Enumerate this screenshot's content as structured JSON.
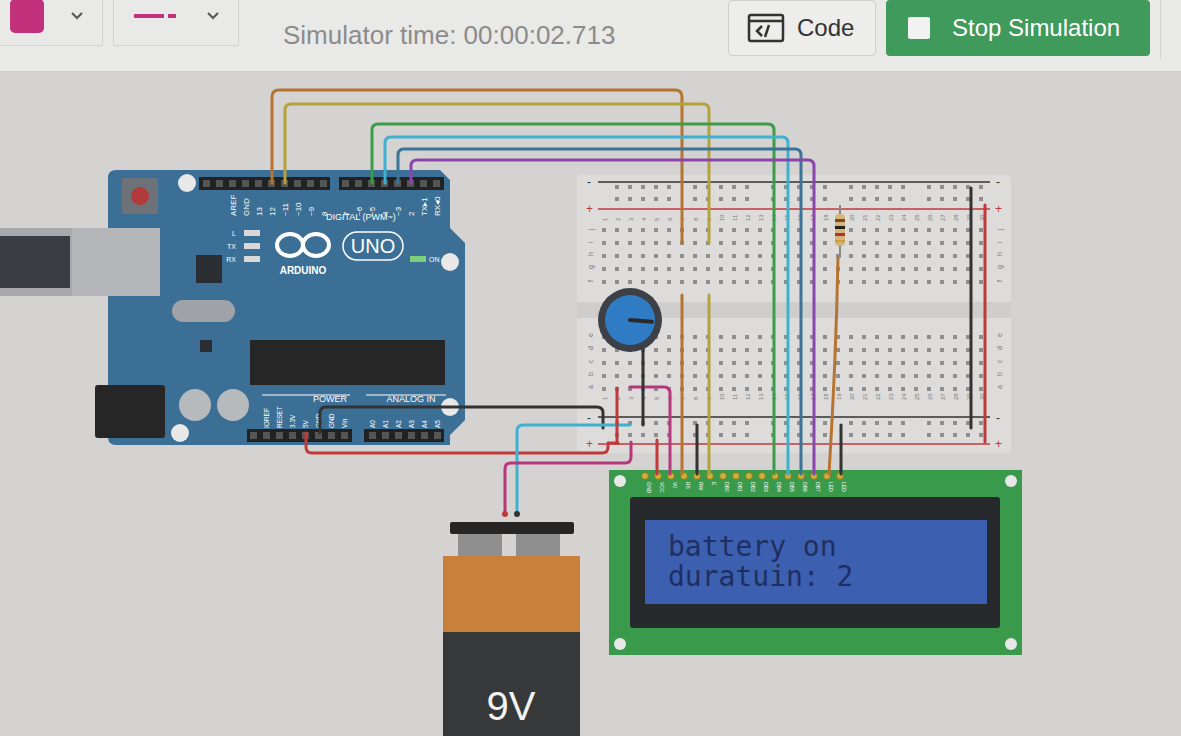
{
  "toolbar": {
    "color_picker": {
      "color": "#c2317c"
    },
    "line_style": {
      "color": "#c2317c"
    },
    "simulator_time": "Simulator time: 00:00:02.713",
    "code_button": {
      "label": "Code"
    },
    "stop_button": {
      "label": "Stop Simulation"
    }
  },
  "arduino": {
    "digital_labels_left": [
      "AREF",
      "GND",
      "13",
      "12",
      "~11",
      "~10",
      "~9",
      "8"
    ],
    "digital_labels_right": [
      "7",
      "~6",
      "~5",
      "4",
      "~3",
      "2",
      "TX▸1",
      "RX◂0"
    ],
    "digital_title": "DIGITAL (PWM~)",
    "led_labels": [
      "L",
      "TX",
      "RX"
    ],
    "on_label": "ON",
    "brand": "ARDUINO",
    "model": "UNO",
    "power_title": "POWER",
    "analog_title": "ANALOG IN",
    "power_labels": [
      "IOREF",
      "RESET",
      "3.3V",
      "5V",
      "GND",
      "GND",
      "Vin"
    ],
    "analog_labels": [
      "A0",
      "A1",
      "A2",
      "A3",
      "A4",
      "A5"
    ]
  },
  "breadboard": {
    "columns": [
      "1",
      "2",
      "3",
      "4",
      "5",
      "6",
      "7",
      "8",
      "9",
      "10",
      "11",
      "12",
      "13",
      "14",
      "15",
      "16",
      "17",
      "18",
      "19",
      "20",
      "21",
      "22",
      "23",
      "24",
      "25",
      "26",
      "27",
      "28",
      "29",
      "30"
    ],
    "rows_top": [
      "j",
      "i",
      "h",
      "g",
      "f"
    ],
    "rows_bottom": [
      "e",
      "d",
      "c",
      "b",
      "a"
    ],
    "rail_minus": "-",
    "rail_plus": "+"
  },
  "potentiometer": {
    "level": 0.85
  },
  "lcd": {
    "lines": [
      "battery on",
      "duratuin: 2"
    ],
    "pins": [
      "GND",
      "VCC",
      "V0",
      "RS",
      "RW",
      "E",
      "DB0",
      "DB1",
      "DB2",
      "DB3",
      "DB4",
      "DB5",
      "DB6",
      "DB7",
      "LED",
      "LED"
    ]
  },
  "battery": {
    "label": "9V"
  },
  "wires": [
    {
      "color": "#b77431"
    },
    {
      "color": "#b5a23c"
    },
    {
      "color": "#3c9c48"
    },
    {
      "color": "#3fb1d0"
    },
    {
      "color": "#3a7598"
    },
    {
      "color": "#8a46ac"
    },
    {
      "color": "#333333"
    },
    {
      "color": "#c0393b"
    },
    {
      "color": "#3fb1d0"
    },
    {
      "color": "#b5387c"
    },
    {
      "color": "#b5387c"
    },
    {
      "color": "#c0393b"
    },
    {
      "color": "#333333"
    },
    {
      "color": "#c0393b"
    },
    {
      "color": "#b77431"
    }
  ]
}
